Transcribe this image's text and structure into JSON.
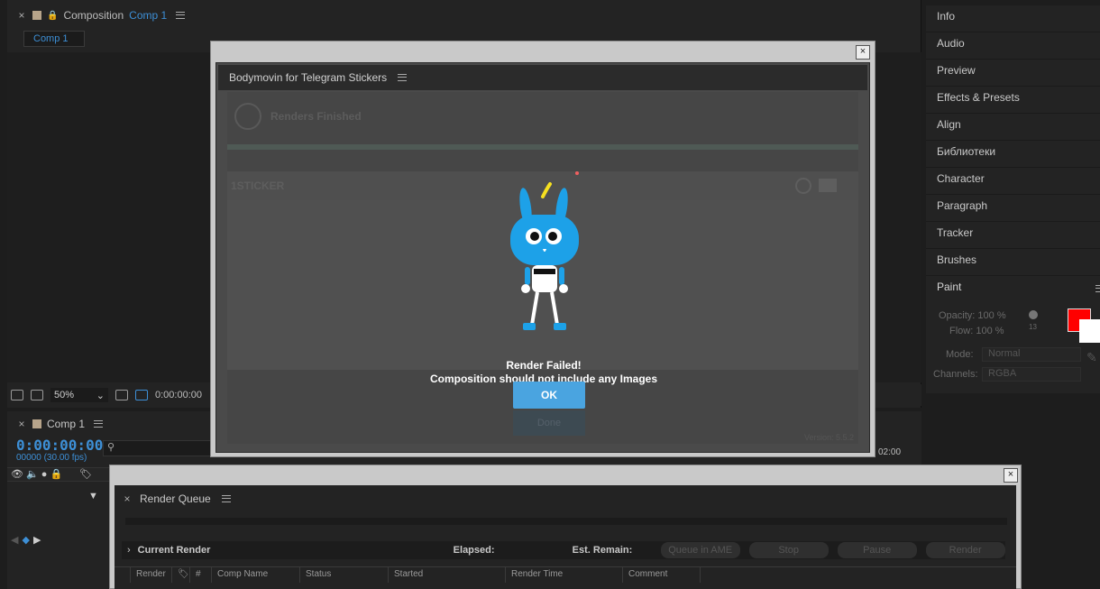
{
  "composition_panel": {
    "title": "Composition",
    "comp_name": "Comp 1",
    "tab_label": "Comp 1",
    "zoom": "50%",
    "timecode": "0:00:00:00"
  },
  "timeline": {
    "comp_name": "Comp 1",
    "timecode": "0:00:00:00",
    "fps": "00000 (30.00 fps)",
    "end_marker": "02:00"
  },
  "right_panel": {
    "items": [
      "Info",
      "Audio",
      "Preview",
      "Effects & Presets",
      "Align",
      "Библиотеки",
      "Character",
      "Paragraph",
      "Tracker",
      "Brushes"
    ],
    "paint": {
      "title": "Paint",
      "opacity_label": "Opacity:",
      "opacity_value": "100 %",
      "flow_label": "Flow:",
      "flow_value": "100 %",
      "brush_size": "13",
      "mode_label": "Mode:",
      "mode_value": "Normal",
      "channels_label": "Channels:",
      "channels_value": "RGBA",
      "colors": {
        "foreground": "#ff0000",
        "background": "#ffffff"
      }
    }
  },
  "bodymovin": {
    "title": "Bodymovin for Telegram Stickers",
    "renders_finished": "Renders Finished",
    "sticker_name": "1STICKER",
    "error_line1": "Render Failed!",
    "error_line2": "Composition should not include any Images",
    "ok_label": "OK",
    "done_label": "Done",
    "version": "Version: 5.5.2",
    "accent_color": "#4aa4e0"
  },
  "render_queue": {
    "title": "Render Queue",
    "current_render": "Current Render",
    "elapsed_label": "Elapsed:",
    "est_remain_label": "Est. Remain:",
    "buttons": [
      "Queue in AME",
      "Stop",
      "Pause",
      "Render"
    ],
    "columns": [
      "Render",
      "#",
      "Comp Name",
      "Status",
      "Started",
      "Render Time",
      "Comment"
    ]
  }
}
